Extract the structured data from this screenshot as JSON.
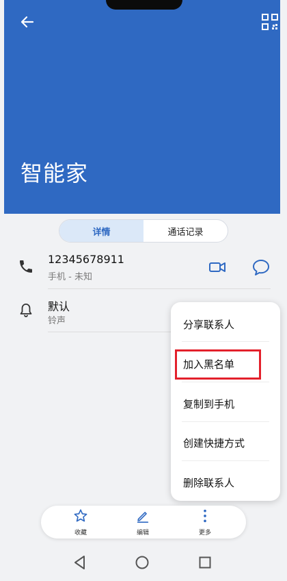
{
  "header": {
    "contact_name": "智能家"
  },
  "tabs": [
    {
      "label": "详情",
      "active": true
    },
    {
      "label": "通话记录",
      "active": false
    }
  ],
  "phone_row": {
    "number": "12345678911",
    "subtitle": "手机 - 未知"
  },
  "ringtone_row": {
    "title": "默认",
    "subtitle": "铃声"
  },
  "menu": {
    "items": [
      {
        "label": "分享联系人"
      },
      {
        "label": "加入黑名单",
        "highlighted": true
      },
      {
        "label": "复制到手机"
      },
      {
        "label": "创建快捷方式"
      },
      {
        "label": "删除联系人"
      }
    ]
  },
  "action_bar": {
    "favorite_label": "收藏",
    "edit_label": "编辑",
    "more_label": "更多"
  },
  "colors": {
    "header_blue": "#2f69c2",
    "accent_blue": "#2f69c2",
    "highlight_red": "#e3202b"
  },
  "icons": [
    "back-arrow-icon",
    "qr-code-icon",
    "phone-icon",
    "video-call-icon",
    "message-icon",
    "bell-icon",
    "star-icon",
    "pencil-icon",
    "more-dots-icon",
    "nav-back-icon",
    "nav-home-icon",
    "nav-recents-icon"
  ]
}
